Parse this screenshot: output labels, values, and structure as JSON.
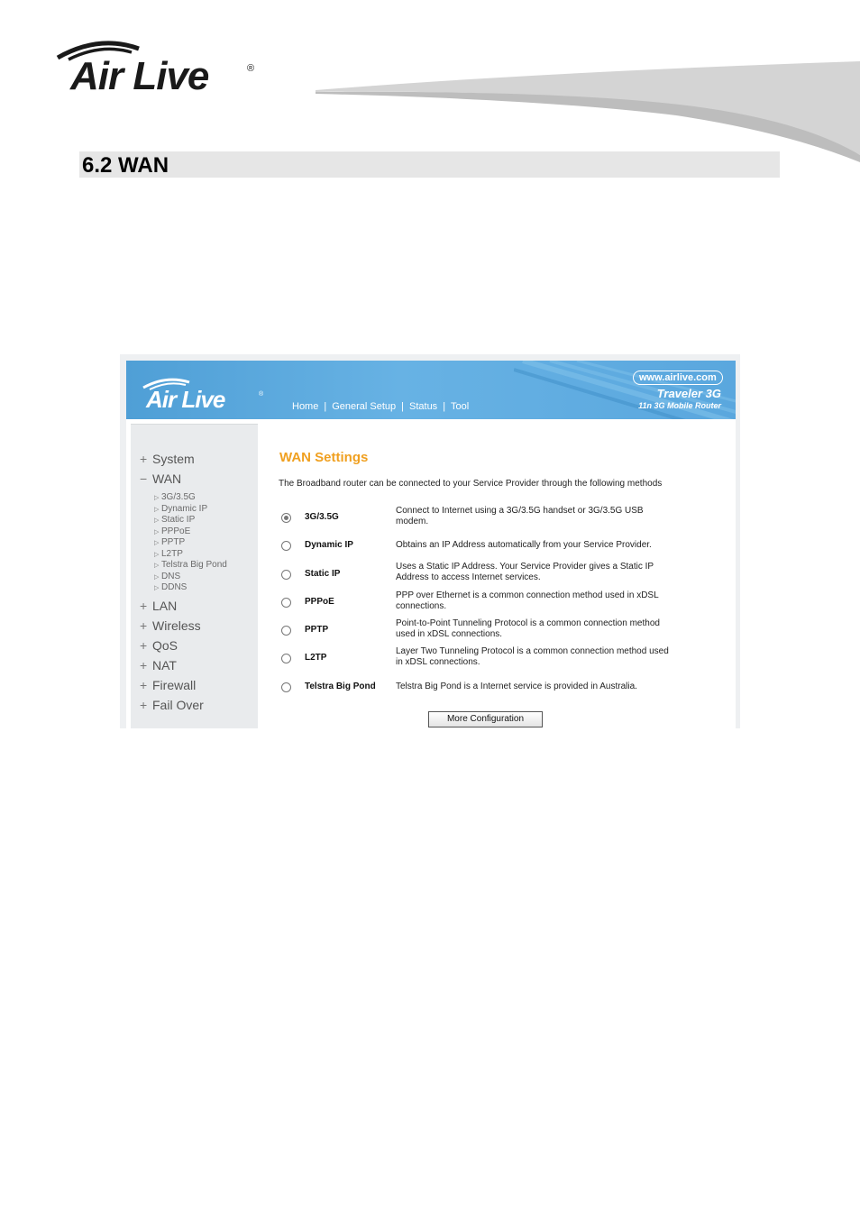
{
  "brand": {
    "name": "Air Live",
    "reg_mark": "®"
  },
  "section": {
    "title": "6.2 WAN"
  },
  "screenshot": {
    "header": {
      "logo": "Air Live",
      "reg_mark": "®",
      "nav": [
        "Home",
        "General Setup",
        "Status",
        "Tool"
      ],
      "nav_sep": "|",
      "url": "www.airlive.com",
      "product": "Traveler 3G",
      "product_sub": "11n 3G Mobile Router"
    },
    "sidebar": {
      "menu_top": [
        {
          "sign": "+",
          "label": "System"
        },
        {
          "sign": "−",
          "label": "WAN"
        }
      ],
      "submenu": [
        "3G/3.5G",
        "Dynamic IP",
        "Static IP",
        "PPPoE",
        "PPTP",
        "L2TP",
        "Telstra Big Pond",
        "DNS",
        "DDNS"
      ],
      "menu_bottom": [
        {
          "sign": "+",
          "label": "LAN"
        },
        {
          "sign": "+",
          "label": "Wireless"
        },
        {
          "sign": "+",
          "label": "QoS"
        },
        {
          "sign": "+",
          "label": "NAT"
        },
        {
          "sign": "+",
          "label": "Firewall"
        },
        {
          "sign": "+",
          "label": "Fail Over"
        }
      ]
    },
    "main": {
      "title": "WAN Settings",
      "intro": "The Broadband router can be connected to your Service Provider through the following methods",
      "options": [
        {
          "label": "3G/3.5G",
          "desc": "Connect to Internet using a 3G/3.5G handset or 3G/3.5G USB modem.",
          "selected": true
        },
        {
          "label": "Dynamic IP",
          "desc": "Obtains an IP Address automatically from your Service Provider.",
          "selected": false
        },
        {
          "label": "Static IP",
          "desc": "Uses a Static IP Address. Your Service Provider gives a Static IP Address to access Internet services.",
          "selected": false
        },
        {
          "label": "PPPoE",
          "desc": "PPP over Ethernet is a common connection method used in xDSL connections.",
          "selected": false
        },
        {
          "label": "PPTP",
          "desc": "Point-to-Point Tunneling Protocol is a common connection method used in xDSL connections.",
          "selected": false
        },
        {
          "label": "L2TP",
          "desc": "Layer Two Tunneling Protocol is a common connection method used in xDSL connections.",
          "selected": false
        },
        {
          "label": "Telstra Big Pond",
          "desc": "Telstra Big Pond is a Internet service is provided in Australia.",
          "selected": false
        }
      ],
      "more_button": "More Configuration"
    }
  }
}
